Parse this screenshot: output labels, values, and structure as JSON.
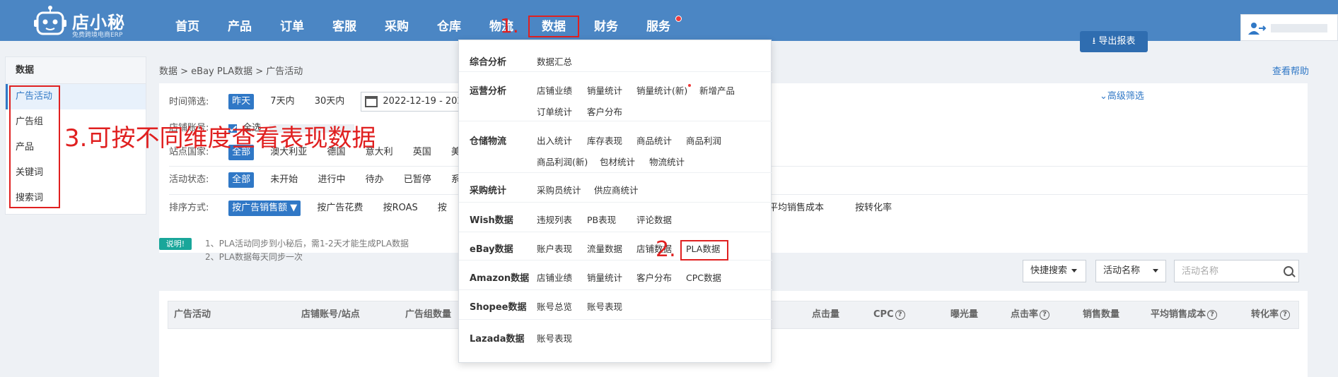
{
  "logo": {
    "name": "店小秘",
    "slogan": "免费跨境电商ERP"
  },
  "nav": [
    "首页",
    "产品",
    "订单",
    "客服",
    "采购",
    "仓库",
    "物流",
    "数据",
    "财务",
    "服务"
  ],
  "annotations": {
    "a1": "1.",
    "a2": "2.",
    "a3": "3.可按不同维度查看表现数据"
  },
  "sidebar": {
    "title": "数据",
    "items": [
      "广告活动",
      "广告组",
      "产品",
      "关键词",
      "搜索词"
    ]
  },
  "breadcrumb": "数据 > eBay PLA数据 > 广告活动",
  "help_link": "查看帮助",
  "filters": {
    "time_label": "时间筛选:",
    "time_opts": [
      "昨天",
      "7天内",
      "30天内"
    ],
    "date_value": "2022-12-19 - 2022-1",
    "shop_label": "店铺账号:",
    "shop_all": "全选",
    "country_label": "站点国家:",
    "country_opts": [
      "全部",
      "澳大利亚",
      "德国",
      "意大利",
      "英国",
      "美"
    ],
    "status_label": "活动状态:",
    "status_opts": [
      "全部",
      "未开始",
      "进行中",
      "待办",
      "已暂停",
      "系"
    ],
    "sort_label": "排序方式:",
    "sort_opts": [
      "按广告销售额 ▼",
      "按广告花费",
      "按ROAS",
      "按"
    ],
    "sort_tail": [
      "按平均销售成本",
      "按转化率"
    ]
  },
  "export_label": "导出报表",
  "adv_filter": "高级筛选",
  "note": {
    "badge": "说明!",
    "line1": "1、PLA活动同步到小秘后，需1-2天才能生成PLA数据",
    "line2": "2、PLA数据每天同步一次"
  },
  "search": {
    "quick": "快捷搜索",
    "field": "活动名称",
    "placeholder": "活动名称"
  },
  "table_headers": [
    "广告活动",
    "店铺账号/站点",
    "广告组数量",
    "点击量",
    "CPC",
    "曝光量",
    "点击率",
    "销售数量",
    "平均销售成本",
    "转化率"
  ],
  "dropdown": [
    {
      "cat": "综合分析",
      "links": [
        "数据汇总"
      ]
    },
    {
      "cat": "运营分析",
      "links": [
        "店铺业绩",
        "销量统计",
        "销量统计(新)",
        "新增产品",
        "订单统计",
        "客户分布"
      ]
    },
    {
      "cat": "仓储物流",
      "links": [
        "出入统计",
        "库存表现",
        "商品统计",
        "商品利润",
        "商品利润(新)",
        "包材统计",
        "物流统计"
      ]
    },
    {
      "cat": "采购统计",
      "links": [
        "采购员统计",
        "供应商统计"
      ]
    },
    {
      "cat": "Wish数据",
      "links": [
        "违规列表",
        "PB表现",
        "评论数据"
      ]
    },
    {
      "cat": "eBay数据",
      "links": [
        "账户表现",
        "流量数据",
        "店铺数据",
        "PLA数据"
      ]
    },
    {
      "cat": "Amazon数据",
      "links": [
        "店铺业绩",
        "销量统计",
        "客户分布",
        "CPC数据"
      ]
    },
    {
      "cat": "Shopee数据",
      "links": [
        "账号总览",
        "账号表现"
      ]
    },
    {
      "cat": "Lazada数据",
      "links": [
        "账号表现"
      ]
    }
  ],
  "colors": {
    "topbar": "#4b86c4",
    "accent": "#3078c6",
    "annotation": "#e02020",
    "badge": "#19a69a"
  }
}
